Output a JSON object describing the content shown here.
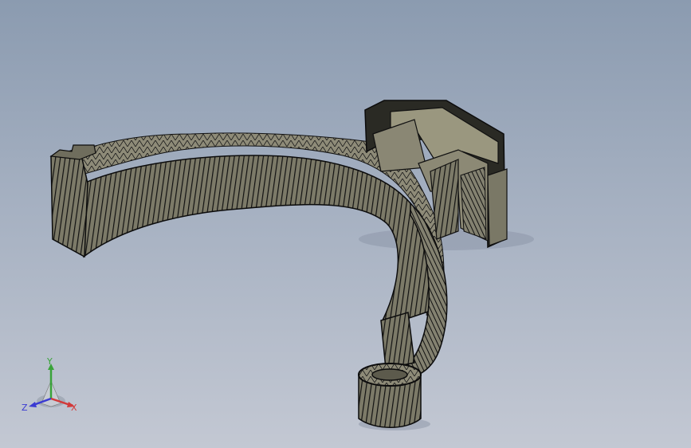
{
  "triad": {
    "x_label": "X",
    "y_label": "Y",
    "z_label": "Z",
    "x_color": "#d23a3a",
    "y_color": "#3aa33a",
    "z_color": "#3a3ad2"
  },
  "model": {
    "fill_color": "#8f8c78",
    "edge_color": "#0b0b0b"
  }
}
